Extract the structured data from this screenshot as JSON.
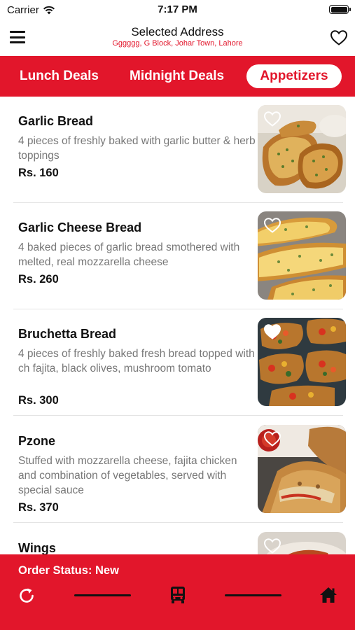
{
  "status_bar": {
    "carrier": "Carrier",
    "time": "7:17 PM"
  },
  "header": {
    "title": "Selected Address",
    "address": "Gggggg, G Block, Johar Town, Lahore"
  },
  "tabs": [
    {
      "label": "Lunch Deals",
      "selected": false
    },
    {
      "label": "Midnight Deals",
      "selected": false
    },
    {
      "label": "Appetizers",
      "selected": true
    }
  ],
  "items": [
    {
      "name": "Garlic Bread",
      "description": "4 pieces of freshly baked with garlic butter & herb toppings",
      "price": "Rs. 160",
      "favorited": false
    },
    {
      "name": "Garlic Cheese Bread",
      "description": "4 baked pieces of garlic bread smothered with melted, real mozzarella cheese",
      "price": "Rs. 260",
      "favorited": false
    },
    {
      "name": "Bruchetta Bread",
      "description": "4 pieces of freshly baked fresh bread topped with ch fajita, black olives, mushroom tomato",
      "price": "Rs. 300",
      "favorited": false
    },
    {
      "name": "Pzone",
      "description": "Stuffed with mozzarella cheese, fajita chicken and combination of vegetables, served with special sauce",
      "price": "Rs. 370",
      "favorited": false
    },
    {
      "name": "Wings",
      "description": "",
      "price": "",
      "favorited": false
    }
  ],
  "footer": {
    "order_status": "Order Status: New"
  },
  "colors": {
    "brand_red": "#e2162b",
    "text_dark": "#111111",
    "text_muted": "#777777",
    "background": "#ffffff"
  },
  "icons": {
    "menu": "hamburger-icon",
    "favorite": "heart-outline-icon",
    "refresh": "refresh-icon",
    "transport": "bus-icon",
    "home": "home-icon"
  }
}
